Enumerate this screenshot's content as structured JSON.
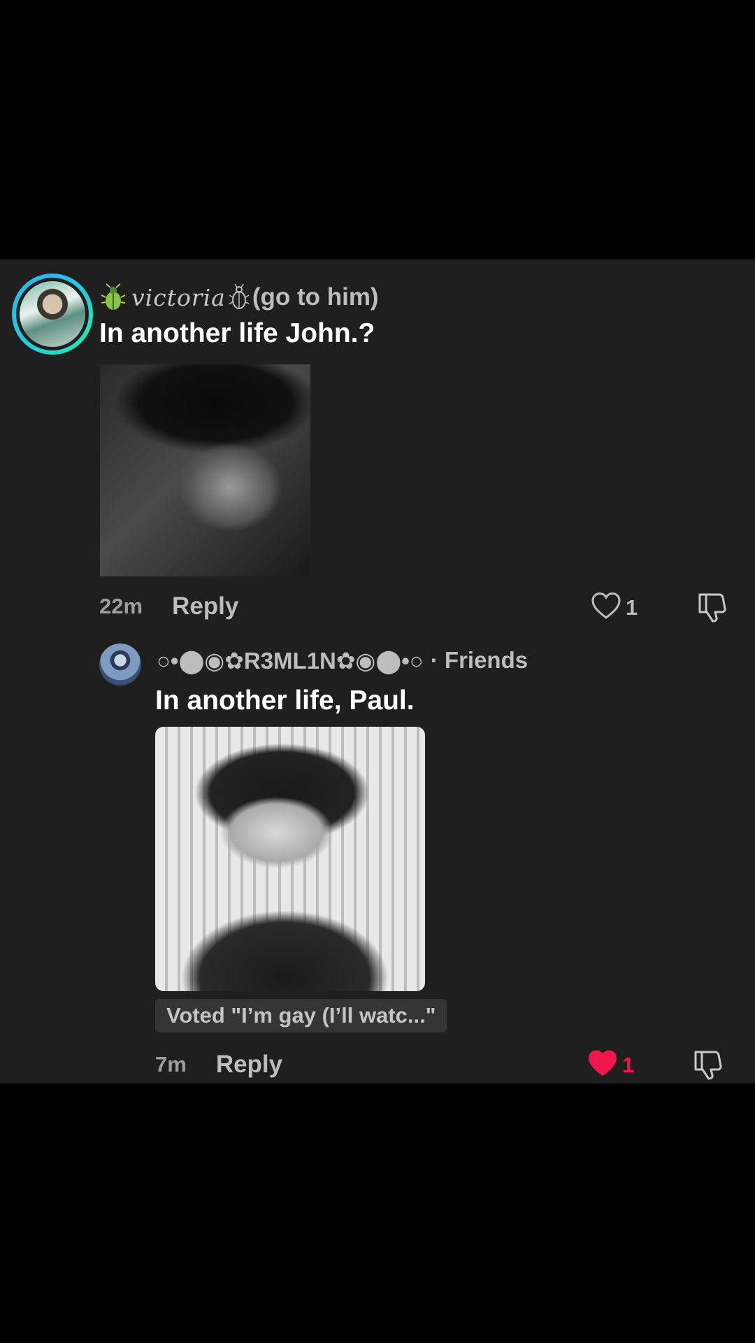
{
  "colors": {
    "background": "#000000",
    "panel": "#1f1f1f",
    "text_primary": "#ffffff",
    "text_secondary": "#bdbdbd",
    "like_active": "#f0164e",
    "ring_gradient": [
      "#29b6f6",
      "#1de9b6"
    ]
  },
  "comments": [
    {
      "username_script": "victoria",
      "username_suffix": "(go to him)",
      "icons": [
        "beetle-icon",
        "bug-outline-icon"
      ],
      "text": "In another life John.?",
      "has_image": true,
      "time": "22m",
      "reply_label": "Reply",
      "like_count": "1",
      "liked": false
    },
    {
      "username": "○•⬤◉✿R3ML1N✿◉⬤•○",
      "friends_label": "· Friends",
      "text": "In another life, Paul.",
      "has_image": true,
      "vote_badge": "Voted \"I’m gay (I’ll watc...\"",
      "time": "7m",
      "reply_label": "Reply",
      "like_count": "1",
      "liked": true
    }
  ]
}
